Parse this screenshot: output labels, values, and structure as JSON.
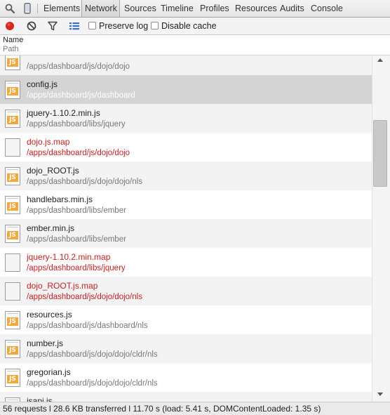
{
  "tabs": [
    {
      "label": "Elements",
      "active": false
    },
    {
      "label": "Network",
      "active": true
    },
    {
      "label": "Sources",
      "active": false
    },
    {
      "label": "Timeline",
      "active": false
    },
    {
      "label": "Profiles",
      "active": false
    },
    {
      "label": "Resources",
      "active": false
    },
    {
      "label": "Audits",
      "active": false
    },
    {
      "label": "Console",
      "active": false
    }
  ],
  "toolbar": {
    "preserve_log": {
      "label": "Preserve log",
      "checked": false
    },
    "disable_cache": {
      "label": "Disable cache",
      "checked": false
    }
  },
  "columns": {
    "name": "Name",
    "path": "Path"
  },
  "requests": [
    {
      "name": "",
      "path": "/apps/dashboard/js/dojo/dojo",
      "type": "js",
      "error": false,
      "selected": false
    },
    {
      "name": "config.js",
      "path": "/apps/dashboard/js/dashboard",
      "type": "js",
      "error": false,
      "selected": true
    },
    {
      "name": "jquery-1.10.2.min.js",
      "path": "/apps/dashboard/libs/jquery",
      "type": "js",
      "error": false,
      "selected": false
    },
    {
      "name": "dojo.js.map",
      "path": "/apps/dashboard/js/dojo/dojo",
      "type": "blank",
      "error": true,
      "selected": false
    },
    {
      "name": "dojo_ROOT.js",
      "path": "/apps/dashboard/js/dojo/dojo/nls",
      "type": "js",
      "error": false,
      "selected": false
    },
    {
      "name": "handlebars.min.js",
      "path": "/apps/dashboard/libs/ember",
      "type": "js",
      "error": false,
      "selected": false
    },
    {
      "name": "ember.min.js",
      "path": "/apps/dashboard/libs/ember",
      "type": "js",
      "error": false,
      "selected": false
    },
    {
      "name": "jquery-1.10.2.min.map",
      "path": "/apps/dashboard/libs/jquery",
      "type": "blank",
      "error": true,
      "selected": false
    },
    {
      "name": "dojo_ROOT.js.map",
      "path": "/apps/dashboard/js/dojo/dojo/nls",
      "type": "blank",
      "error": true,
      "selected": false
    },
    {
      "name": "resources.js",
      "path": "/apps/dashboard/js/dashboard/nls",
      "type": "js",
      "error": false,
      "selected": false
    },
    {
      "name": "number.js",
      "path": "/apps/dashboard/js/dojo/dojo/cldr/nls",
      "type": "js",
      "error": false,
      "selected": false
    },
    {
      "name": "gregorian.js",
      "path": "/apps/dashboard/js/dojo/dojo/cldr/nls",
      "type": "js",
      "error": false,
      "selected": false
    },
    {
      "name": "jsapi.js",
      "path": "",
      "type": "js",
      "error": false,
      "selected": false
    }
  ],
  "status": {
    "text": "56 requests l 28.6 KB transferred l 11.70 s (load: 5.41 s, DOMContentLoaded: 1.35 s)"
  },
  "icons": {
    "inspect": "magnifier-icon",
    "device": "mobile-device-icon",
    "record": "record-icon",
    "clear": "clear-icon",
    "filter": "filter-icon",
    "view": "list-view-icon",
    "file_js": "js-file-icon",
    "file_blank": "blank-file-icon"
  },
  "colors": {
    "record": "#d8271e",
    "error_text": "#cc1e1e",
    "js_badge": "#f2a93a"
  }
}
